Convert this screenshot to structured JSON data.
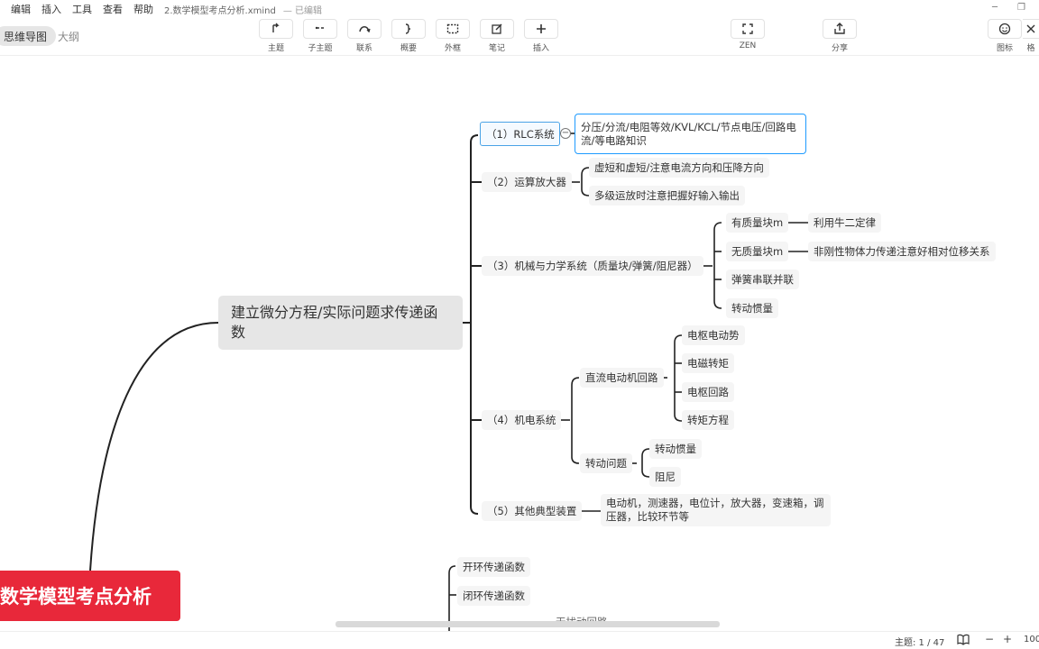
{
  "menu": [
    "编辑",
    "插入",
    "工具",
    "查看",
    "帮助"
  ],
  "file": {
    "name": "2.数学模型考点分析.xmind",
    "status": "— 已编辑"
  },
  "views": {
    "active": "思维导图",
    "inactive": "大纲"
  },
  "toolbar": {
    "topic": "主题",
    "subtopic": "子主题",
    "relation": "联系",
    "summary": "概要",
    "boundary": "外框",
    "note": "笔记",
    "insert": "插入",
    "zen": "ZEN",
    "share": "分享",
    "icon": "图标",
    "format": "格"
  },
  "map": {
    "root": "数学模型考点分析",
    "main_topic": "建立微分方程/实际问题求传递函数",
    "branches": {
      "rlc": "（1）RLC系统",
      "rlc_detail": "分压/分流/电阻等效/KVL/KCL/节点电压/回路电流/等电路知识",
      "opamp": "（2）运算放大器",
      "opamp_a": "虚短和虚短/注意电流方向和压降方向",
      "opamp_b": "多级运放时注意把握好输入输出",
      "mech": "（3）机械与力学系统（质量块/弹簧/阻尼器）",
      "mech_a": "有质量块m",
      "mech_a1": "利用牛二定律",
      "mech_b": "无质量块m",
      "mech_b1": "非刚性物体力传递注意好相对位移关系",
      "mech_c": "弹簧串联并联",
      "mech_d": "转动惯量",
      "elec": "（4）机电系统",
      "dc": "直流电动机回路",
      "dc_a": "电枢电动势",
      "dc_b": "电磁转矩",
      "dc_c": "电枢回路",
      "dc_d": "转矩方程",
      "rot": "转动问题",
      "rot_a": "转动惯量",
      "rot_b": "阻尼",
      "other": "（5）其他典型装置",
      "other_detail": "电动机，测速器，电位计，放大器，变速箱，调压器，比较环节等"
    },
    "second": {
      "open": "开环传递函数",
      "closed": "闭环传递函数",
      "partial": "无扰动回路"
    }
  },
  "statusbar": {
    "topics": "主题: 1 / 47",
    "minus": "−",
    "plus": "+",
    "zoom": "100"
  }
}
